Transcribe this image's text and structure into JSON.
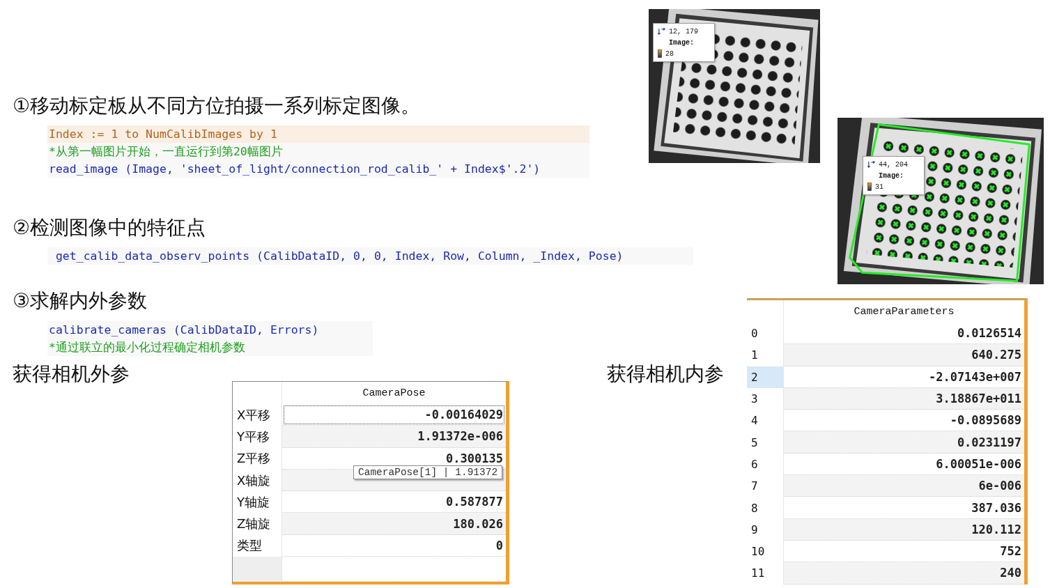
{
  "steps": [
    {
      "title": "①移动标定板从不同方位拍摄一系列标定图像。",
      "lines": [
        {
          "kind": "loop",
          "text": "Index := 1 to NumCalibImages by 1",
          "highlighted": true
        },
        {
          "kind": "comment",
          "text": "*从第一幅图片开始，一直运行到第20幅图片",
          "highlighted": false
        },
        {
          "kind": "code",
          "text": "read_image (Image, 'sheet_of_light/connection_rod_calib_' + Index$'.2')",
          "highlighted": false
        }
      ]
    },
    {
      "title": "②检测图像中的特征点",
      "lines": [
        {
          "kind": "code",
          "text": " get_calib_data_observ_points (CalibDataID, 0, 0, Index, Row, Column, _Index, Pose)",
          "highlighted": false
        }
      ]
    },
    {
      "title": "③求解内外参数",
      "lines": [
        {
          "kind": "code",
          "text": "calibrate_cameras (CalibDataID, Errors)",
          "highlighted": false
        },
        {
          "kind": "comment",
          "text": "*通过联立的最小化过程确定相机参数",
          "highlighted": false
        }
      ]
    }
  ],
  "images": [
    {
      "kind": "picture",
      "marked": false,
      "readout": {
        "coords": "12, 179",
        "channel": "Image:",
        "value": "28"
      }
    },
    {
      "kind": "picture",
      "marked": true,
      "readout": {
        "coords": "44, 204",
        "channel": "Image:",
        "value": "31"
      }
    }
  ],
  "pose": {
    "caption": "获得相机外参",
    "header": "CameraPose",
    "rows": [
      {
        "label": "X平移",
        "value": "-0.00164029",
        "focused": true
      },
      {
        "label": "Y平移",
        "value": "1.91372e-006",
        "focused": false
      },
      {
        "label": "Z平移",
        "value": "0.300135",
        "focused": false
      },
      {
        "label": "X轴旋",
        "focused": false
      },
      {
        "label": "Y轴旋",
        "value": "0.587877",
        "focused": false
      },
      {
        "label": "Z轴旋",
        "value": "180.026",
        "focused": false
      },
      {
        "label": "类型",
        "value": "0",
        "focused": false
      }
    ],
    "tooltip": "CameraPose[1] | 1.91372"
  },
  "params": {
    "caption": "获得相机内参",
    "header": "CameraParameters",
    "rows": [
      {
        "label": "0",
        "value": "0.0126514",
        "selected": false
      },
      {
        "label": "1",
        "value": "640.275",
        "selected": false
      },
      {
        "label": "2",
        "value": "-2.07143e+007",
        "selected": true
      },
      {
        "label": "3",
        "value": "3.18867e+011",
        "selected": false
      },
      {
        "label": "4",
        "value": "-0.0895689",
        "selected": false
      },
      {
        "label": "5",
        "value": "0.0231197",
        "selected": false
      },
      {
        "label": "6",
        "value": "6.00051e-006",
        "selected": false
      },
      {
        "label": "7",
        "value": "6e-006",
        "selected": false
      },
      {
        "label": "8",
        "value": "387.036",
        "selected": false
      },
      {
        "label": "9",
        "value": "120.112",
        "selected": false
      },
      {
        "label": "10",
        "value": "752",
        "selected": false
      },
      {
        "label": "11",
        "value": "240",
        "selected": false
      }
    ]
  }
}
